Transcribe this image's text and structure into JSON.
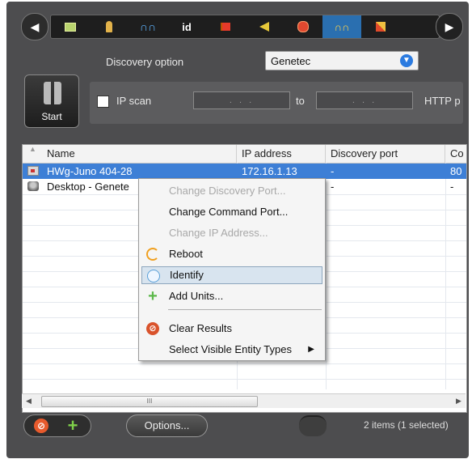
{
  "toolbar": {
    "tabs": [
      {
        "icon": "id-card-icon"
      },
      {
        "icon": "person-icon"
      },
      {
        "icon": "binoculars-blue-icon"
      },
      {
        "icon": "id-text-icon",
        "label": "id"
      },
      {
        "icon": "red-flag-icon"
      },
      {
        "icon": "horn-icon"
      },
      {
        "icon": "red-dot-icon"
      },
      {
        "icon": "binoculars-active-icon",
        "active": true
      },
      {
        "icon": "tools-icon"
      }
    ]
  },
  "discovery": {
    "option_label": "Discovery option",
    "option_value": "Genetec",
    "start_label": "Start",
    "ip_scan_label": "IP scan",
    "ip_from": ". . .",
    "to_label": "to",
    "ip_to": ". . .",
    "http_label": "HTTP p"
  },
  "table": {
    "columns": [
      "Name",
      "IP address",
      "Discovery port",
      "Co"
    ],
    "rows": [
      {
        "name": "HWg-Juno 404-28",
        "ip": "172.16.1.13",
        "discovery_port": "-",
        "command_port": "80",
        "icon": "camera-icon",
        "selected": true
      },
      {
        "name": "Desktop - Genete",
        "ip": "",
        "discovery_port": "-",
        "command_port": "-",
        "icon": "computer-icon",
        "selected": false
      }
    ]
  },
  "scrollbar": {
    "thumb_label": "III"
  },
  "context_menu": {
    "items": [
      {
        "label": "Change Discovery Port...",
        "enabled": false
      },
      {
        "label": "Change Command Port...",
        "enabled": true
      },
      {
        "label": "Change IP Address...",
        "enabled": false
      },
      {
        "label": "Reboot",
        "enabled": true,
        "icon": "reboot-icon"
      },
      {
        "label": "Identify",
        "enabled": true,
        "icon": "identify-icon",
        "highlighted": true
      },
      {
        "label": "Add Units...",
        "enabled": true,
        "icon": "add-icon"
      },
      {
        "label": "Clear Results",
        "enabled": true,
        "icon": "clear-icon"
      },
      {
        "label": "Select Visible Entity Types",
        "enabled": true,
        "submenu": true
      }
    ]
  },
  "bottom": {
    "options_label": "Options...",
    "status": "2 items (1 selected)"
  },
  "colors": {
    "frame": "#4d4d4f",
    "selection": "#3d7fd6",
    "active_tab": "#2a6fb0",
    "menu_highlight": "#d8e4ef"
  }
}
